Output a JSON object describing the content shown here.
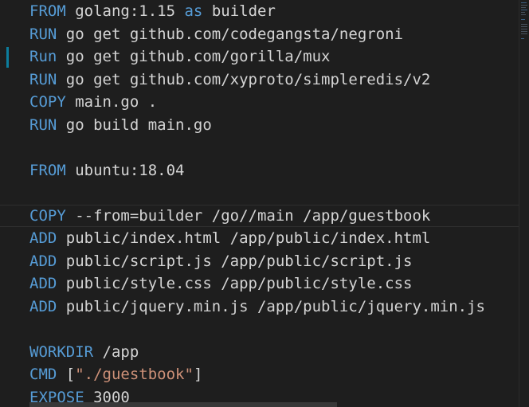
{
  "editor": {
    "language": "dockerfile",
    "colors": {
      "background": "#1e1e1e",
      "keyword": "#569cd6",
      "text": "#d4d4d4",
      "string": "#ce9178",
      "modified_marker": "#0c7d9d"
    },
    "lines": [
      {
        "keyword": "FROM",
        "rest": " golang:1.15 ",
        "keyword2": "as",
        "rest2": " builder"
      },
      {
        "keyword": "RUN",
        "rest": " go get github.com/codegangsta/negroni"
      },
      {
        "keyword": "Run",
        "rest": " go get github.com/gorilla/mux",
        "modified": true
      },
      {
        "keyword": "RUN",
        "rest": " go get github.com/xyproto/simpleredis/v2"
      },
      {
        "keyword": "COPY",
        "rest": " main.go ."
      },
      {
        "keyword": "RUN",
        "rest": " go build main.go"
      },
      {
        "keyword": "",
        "rest": ""
      },
      {
        "keyword": "FROM",
        "rest": " ubuntu:18.04"
      },
      {
        "keyword": "",
        "rest": ""
      },
      {
        "keyword": "COPY",
        "rest": " --from=builder /go//main /app/guestbook",
        "current": true
      },
      {
        "keyword": "ADD",
        "rest": " public/index.html /app/public/index.html"
      },
      {
        "keyword": "ADD",
        "rest": " public/script.js /app/public/script.js"
      },
      {
        "keyword": "ADD",
        "rest": " public/style.css /app/public/style.css"
      },
      {
        "keyword": "ADD",
        "rest": " public/jquery.min.js /app/public/jquery.min.js"
      },
      {
        "keyword": "",
        "rest": ""
      },
      {
        "keyword": "WORKDIR",
        "rest": " /app"
      },
      {
        "keyword": "CMD",
        "rest": " [",
        "string": "\"./guestbook\"",
        "rest2": "]"
      },
      {
        "keyword": "EXPOSE",
        "rest": " 3000"
      }
    ]
  }
}
